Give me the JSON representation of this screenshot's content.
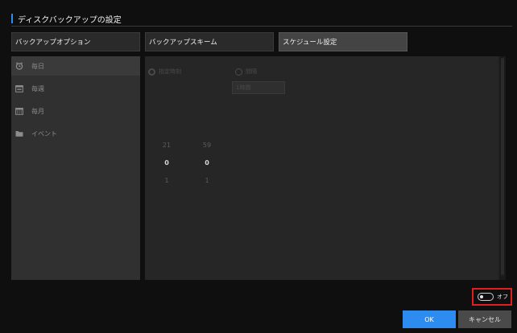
{
  "dialog": {
    "title": "ディスクバックアップの設定"
  },
  "tabs": [
    {
      "label": "バックアップオプション"
    },
    {
      "label": "バックアップスキーム"
    },
    {
      "label": "スケジュール設定",
      "active": true
    }
  ],
  "sidebar": {
    "items": [
      {
        "label": "毎日",
        "icon": "clock-icon",
        "active": true
      },
      {
        "label": "毎週",
        "icon": "calendar-week-icon"
      },
      {
        "label": "毎月",
        "icon": "calendar-month-icon"
      },
      {
        "label": "イベント",
        "icon": "folder-icon"
      }
    ]
  },
  "schedule": {
    "radio_specific_time": "指定時刻",
    "radio_interval": "間隔",
    "interval_value": "1時間",
    "hours": [
      "",
      "",
      "",
      "21",
      "0",
      "1",
      "",
      ""
    ],
    "minutes": [
      "",
      "",
      "",
      "59",
      "0",
      "1",
      "",
      ""
    ]
  },
  "footer": {
    "toggle_label": "オフ",
    "toggle_on": false,
    "ok_label": "OK",
    "cancel_label": "キャンセル"
  },
  "colors": {
    "accent": "#2d8cf0",
    "highlight": "#e02020"
  }
}
